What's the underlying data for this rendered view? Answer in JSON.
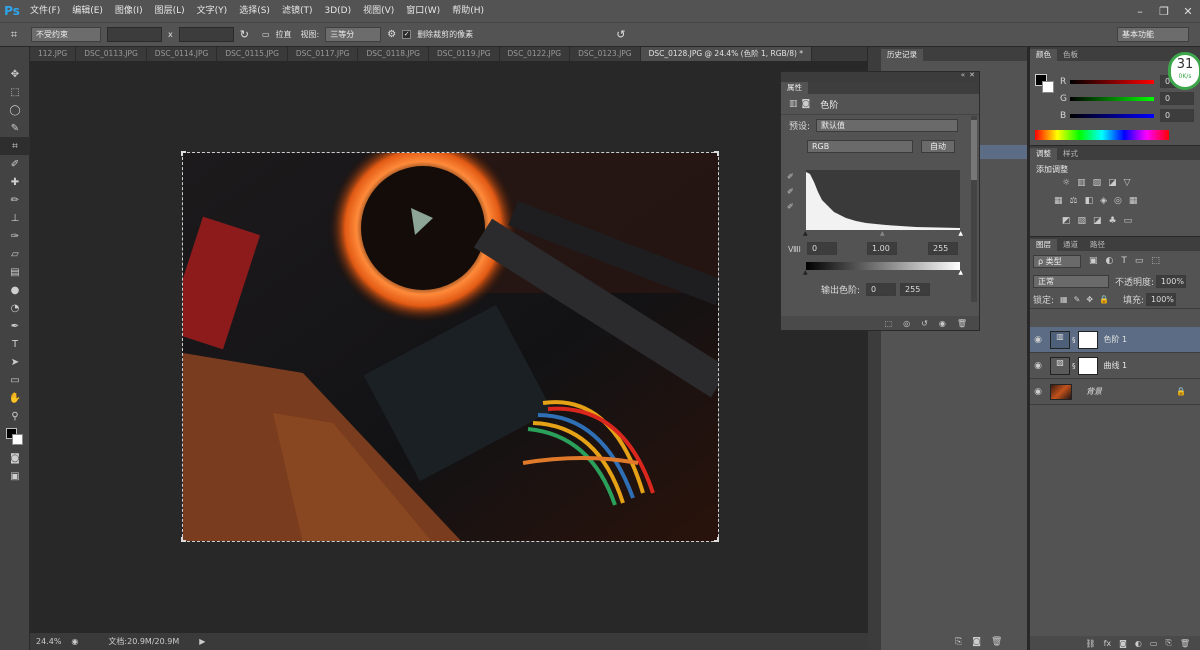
{
  "app": {
    "logo": "Ps"
  },
  "menu": [
    "文件(F)",
    "编辑(E)",
    "图像(I)",
    "图层(L)",
    "文字(Y)",
    "选择(S)",
    "滤镜(T)",
    "3D(D)",
    "视图(V)",
    "窗口(W)",
    "帮助(H)"
  ],
  "window": {
    "minimize": "–",
    "restore": "❐",
    "close": "✕"
  },
  "options": {
    "ratio": "不受约束",
    "x_sep": "x",
    "straighten": "拉直",
    "view_label": "视图:",
    "view_value": "三等分",
    "delete_cropped": "删除裁剪的像素",
    "workspace": "基本功能"
  },
  "tabs": [
    {
      "label": "112.JPG",
      "active": false
    },
    {
      "label": "DSC_0113.JPG",
      "active": false
    },
    {
      "label": "DSC_0114.JPG",
      "active": false
    },
    {
      "label": "DSC_0115.JPG",
      "active": false
    },
    {
      "label": "DSC_0117.JPG",
      "active": false
    },
    {
      "label": "DSC_0118.JPG",
      "active": false
    },
    {
      "label": "DSC_0119.JPG",
      "active": false
    },
    {
      "label": "DSC_0122.JPG",
      "active": false
    },
    {
      "label": "DSC_0123.JPG",
      "active": false
    },
    {
      "label": "DSC_0128.JPG @ 24.4% (色阶 1, RGB/8) *",
      "active": true
    }
  ],
  "status": {
    "zoom": "24.4%",
    "doc": "文档:20.9M/20.9M"
  },
  "history": {
    "tab": "历史记录"
  },
  "properties": {
    "title": "属性",
    "adj_name": "色阶",
    "preset_label": "预设:",
    "preset_value": "默认值",
    "channel": "RGB",
    "auto": "自动",
    "input_black": "0",
    "input_gamma": "1.00",
    "input_white": "255",
    "output_label": "输出色阶:",
    "output_black": "0",
    "output_white": "255"
  },
  "color": {
    "tab1": "颜色",
    "tab2": "色板",
    "r_label": "R",
    "g_label": "G",
    "b_label": "B",
    "r": "0",
    "g": "0",
    "b": "0"
  },
  "adjustments": {
    "tab1": "调整",
    "tab2": "样式",
    "heading": "添加调整"
  },
  "layers": {
    "tabs": [
      "图层",
      "通道",
      "路径"
    ],
    "kind": "ρ 类型",
    "blend": "正常",
    "opacity_label": "不透明度:",
    "opacity": "100%",
    "lock_label": "锁定:",
    "fill_label": "填充:",
    "fill": "100%",
    "items": [
      {
        "name": "色阶 1",
        "selected": true
      },
      {
        "name": "曲线 1",
        "selected": false
      },
      {
        "name": "背景",
        "selected": false
      }
    ]
  },
  "widget": {
    "value": "31",
    "unit": "%",
    "sub": "0K/s"
  }
}
